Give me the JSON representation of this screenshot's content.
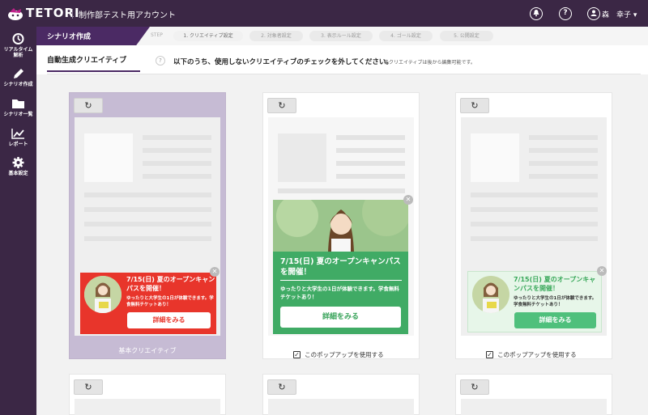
{
  "header": {
    "logo_text": "TETORI",
    "account": "制作部テスト用アカウント",
    "user": "森　幸子",
    "help_glyph": "?",
    "bell_glyph": "●",
    "caret": "▾"
  },
  "sidebar": {
    "items": [
      {
        "label": "リアルタイム\n解析",
        "icon": "realtime-icon",
        "glyph": "◷"
      },
      {
        "label": "シナリオ作成",
        "icon": "pencil-icon",
        "glyph": "✎"
      },
      {
        "label": "シナリオ一覧",
        "icon": "folder-icon",
        "glyph": "▬"
      },
      {
        "label": "レポート",
        "icon": "chart-line-icon",
        "glyph": "⟋"
      },
      {
        "label": "基本設定",
        "icon": "gear-icon",
        "glyph": "⚙"
      }
    ]
  },
  "page": {
    "title": "シナリオ作成",
    "step_label": "STEP",
    "steps": [
      "1. クリエイティブ設定",
      "2. 対象者設定",
      "3. 表示ルール設定",
      "4. ゴール設定",
      "5. 公開設定"
    ]
  },
  "tab": {
    "label": "自動生成クリエイティブ",
    "help": "?"
  },
  "instructions": {
    "main": "以下のうち、使用しないクリエイティブのチェックを外してください。",
    "sub": "各クリエイティブは後から編集可能です。"
  },
  "refresh_glyph": "↻",
  "close_glyph": "✕",
  "cards": [
    {
      "title": "7/15(日) 夏のオープンキャンパスを開催！",
      "body": "ゆったりと大学生の1日が体験できます。学食無料チケットあり！",
      "button": "詳細をみる",
      "footer": "基本クリエイティブ",
      "selected": true,
      "color": "#e8352b"
    },
    {
      "title": "7/15(日) 夏のオープンキャンパスを開催！",
      "body": "ゆったりと大学生の1日が体験できます。学食無料チケットあり！",
      "button": "詳細をみる",
      "footer": "このポップアップを使用する",
      "checked": true,
      "color": "#5ab06c"
    },
    {
      "title": "7/15(日) 夏のオープンキャンパスを開催！",
      "body": "ゆったりと大学生の1日が体験できます。学食無料チケットあり！",
      "button": "詳細をみる",
      "footer": "このポップアップを使用する",
      "checked": true,
      "color": "#e7f6e9"
    }
  ],
  "check_glyph": "✓"
}
